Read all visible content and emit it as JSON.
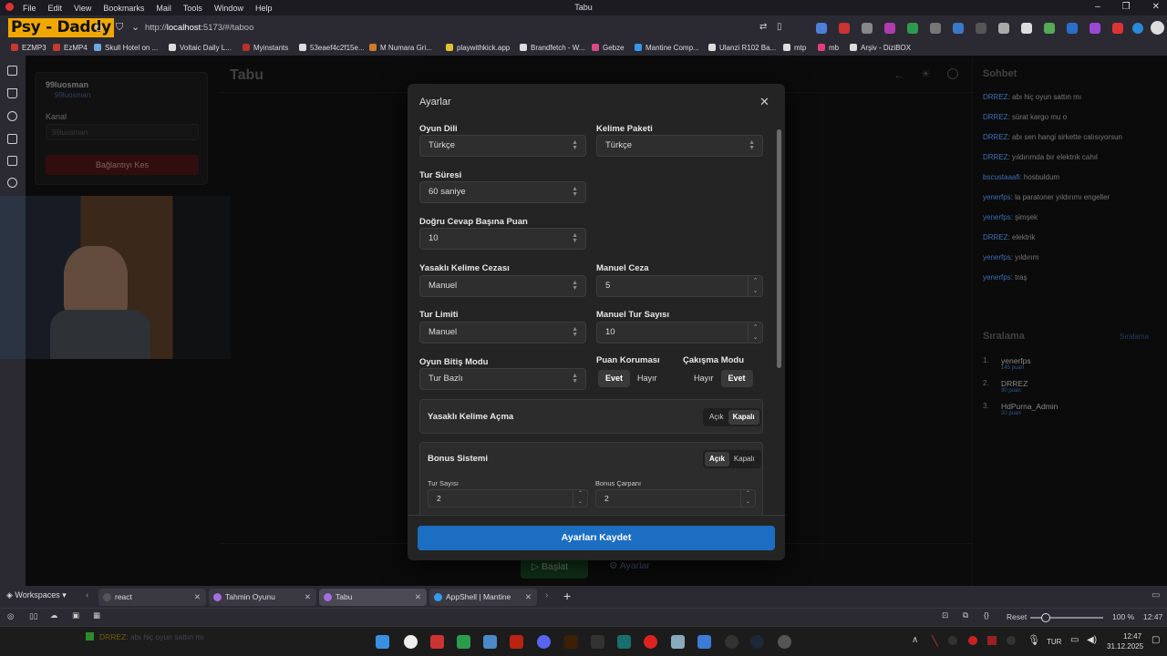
{
  "menubar": {
    "items": [
      "File",
      "Edit",
      "View",
      "Bookmarks",
      "Mail",
      "Tools",
      "Window",
      "Help"
    ],
    "title": "Tabu"
  },
  "navbar": {
    "logo": "Psy - Daddy",
    "url_prefix": "http://",
    "url_host": "localhost",
    "url_rest": ":5173/#/taboo"
  },
  "bookmarks": [
    {
      "label": "EZMP3",
      "color": "#c63b2e"
    },
    {
      "label": "EzMP4",
      "color": "#c63b2e"
    },
    {
      "label": "Skull Hotel on ...",
      "color": "#6aa9e0"
    },
    {
      "label": "Voltaic Daily L...",
      "color": "#dddddd"
    },
    {
      "label": "Myinstants",
      "color": "#b8302a"
    },
    {
      "label": "53eaef4c2f15e...",
      "color": "#dddddd"
    },
    {
      "label": "M Numara Gri...",
      "color": "#d07a2a"
    },
    {
      "label": "playwithkick.app",
      "color": "#e2c032"
    },
    {
      "label": "Brandfetch - W...",
      "color": "#dddddd"
    },
    {
      "label": "Gebze",
      "color": "#d94b86"
    },
    {
      "label": "Mantine Comp...",
      "color": "#339af0"
    },
    {
      "label": "Ulanzi R102 Ba...",
      "color": "#dddddd"
    },
    {
      "label": "mtp",
      "color": "#dddddd"
    },
    {
      "label": "mb",
      "color": "#e33d7a"
    },
    {
      "label": "Arşiv - DiziBOX",
      "color": "#dddddd"
    }
  ],
  "app": {
    "title": "Tabu",
    "user": "99luosman",
    "user_sub": "99luosman",
    "channel_label": "Kanal",
    "channel_value": "99luosman",
    "disconnect": "Bağlantıyı Kes",
    "start_label": "Başlat",
    "settings_label": "Ayarlar"
  },
  "modal": {
    "title": "Ayarlar",
    "game_language": {
      "label": "Oyun Dili",
      "value": "Türkçe"
    },
    "word_pack": {
      "label": "Kelime Paketi",
      "value": "Türkçe"
    },
    "round_time": {
      "label": "Tur Süresi",
      "value": "60 saniye"
    },
    "points_per_answer": {
      "label": "Doğru Cevap Başına Puan",
      "value": "10"
    },
    "forbidden_penalty": {
      "label": "Yasaklı Kelime Cezası",
      "value": "Manuel"
    },
    "manual_penalty": {
      "label": "Manuel Ceza",
      "value": "5"
    },
    "round_limit": {
      "label": "Tur Limiti",
      "value": "Manuel"
    },
    "manual_rounds": {
      "label": "Manuel Tur Sayısı",
      "value": "10"
    },
    "end_mode": {
      "label": "Oyun Bitiş Modu",
      "value": "Tur Bazlı"
    },
    "point_protection": {
      "label": "Puan Koruması",
      "yes": "Evet",
      "no": "Hayır",
      "selected": "yes"
    },
    "conflict_mode": {
      "label": "Çakışma Modu",
      "no": "Hayır",
      "yes": "Evet",
      "selected": "yes"
    },
    "forbidden_reveal": {
      "label": "Yasaklı Kelime Açma",
      "on": "Açık",
      "off": "Kapalı",
      "selected": "off"
    },
    "bonus": {
      "label": "Bonus Sistemi",
      "on": "Açık",
      "off": "Kapalı",
      "selected": "on",
      "rounds_label": "Tur Sayısı",
      "rounds_value": "2",
      "multiplier_label": "Bonus Çarpanı",
      "multiplier_value": "2"
    },
    "save": "Ayarları Kaydet"
  },
  "chat": {
    "title": "Sohbet",
    "messages": [
      {
        "user": "DRREZ",
        "text": "abı hiç oyun sattın mı"
      },
      {
        "user": "DRREZ",
        "text": "sürat kargo mu o"
      },
      {
        "user": "DRREZ",
        "text": "abı sen hangi sirkette calısıyorsun"
      },
      {
        "user": "DRREZ",
        "text": "yıldırımda bır elektrık cahıl"
      },
      {
        "user": "bscustaaafi",
        "text": "hosbuldum"
      },
      {
        "user": "yenerfps",
        "text": "la paratoner yıldırımı engeller"
      },
      {
        "user": "yenerfps",
        "text": "şimşek"
      },
      {
        "user": "DRREZ",
        "text": "elektrik"
      },
      {
        "user": "yenerfps",
        "text": "yıldırım"
      },
      {
        "user": "yenerfps",
        "text": "traş"
      }
    ]
  },
  "ranking": {
    "title": "Sıralama",
    "link": "Sıralama",
    "items": [
      {
        "rank": "1.",
        "name": "yenerfps",
        "score": "145 puan"
      },
      {
        "rank": "2.",
        "name": "DRREZ",
        "score": "30 puan"
      },
      {
        "rank": "3.",
        "name": "HdPurna_Admin",
        "score": "20 puan"
      }
    ]
  },
  "tabs": {
    "workspaces": "Workspaces",
    "items": [
      {
        "label": "react",
        "color": "#555555"
      },
      {
        "label": "Tahmin Oyunu",
        "color": "#a56de2"
      },
      {
        "label": "Tabu",
        "color": "#a56de2"
      },
      {
        "label": "AppShell | Mantine",
        "color": "#339af0"
      }
    ]
  },
  "status": {
    "reset": "Reset",
    "zoom": "100 %",
    "time": "12:47"
  },
  "ticker": {
    "user": "DRREZ",
    "text": "abı hiç oyun sattın mı"
  },
  "tray": {
    "lang": "TUR",
    "time": "12:47",
    "date": "31.12.2025"
  }
}
